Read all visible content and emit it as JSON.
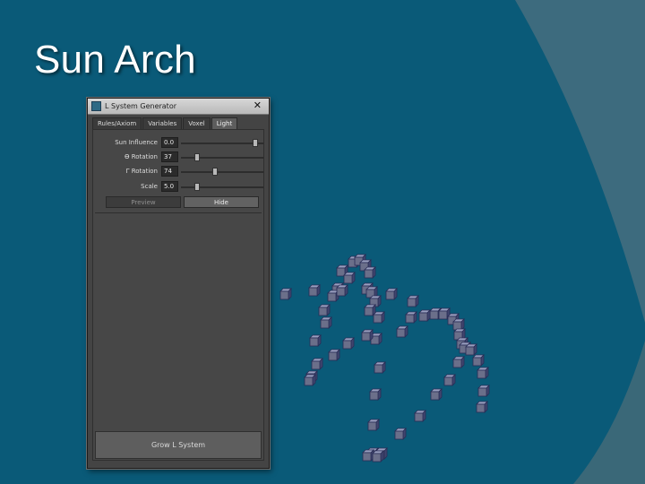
{
  "slide": {
    "title": "Sun Arch"
  },
  "colors": {
    "background": "#0a5a78",
    "arc": "#3d6b7e",
    "window": "#444444",
    "cube": "#6b6f8a"
  },
  "window": {
    "title": "L System Generator",
    "close": "✕",
    "tabs": [
      "Rules/Axiom",
      "Variables",
      "Voxel",
      "Light"
    ],
    "active_tab": "Light",
    "fields": [
      {
        "label": "Sun Influence",
        "value": "0.0",
        "slider": 0.9
      },
      {
        "label": "Ɵ Rotation",
        "value": "37",
        "slider": 0.2
      },
      {
        "label": "Γ Rotation",
        "value": "74",
        "slider": 0.41
      },
      {
        "label": "Scale",
        "value": "5.0",
        "slider": 0.2
      }
    ],
    "preview_button": "Preview",
    "hide_button": "Hide",
    "grow_button": "Grow L System"
  },
  "icons": {
    "app": "app-icon",
    "close": "close-icon"
  }
}
